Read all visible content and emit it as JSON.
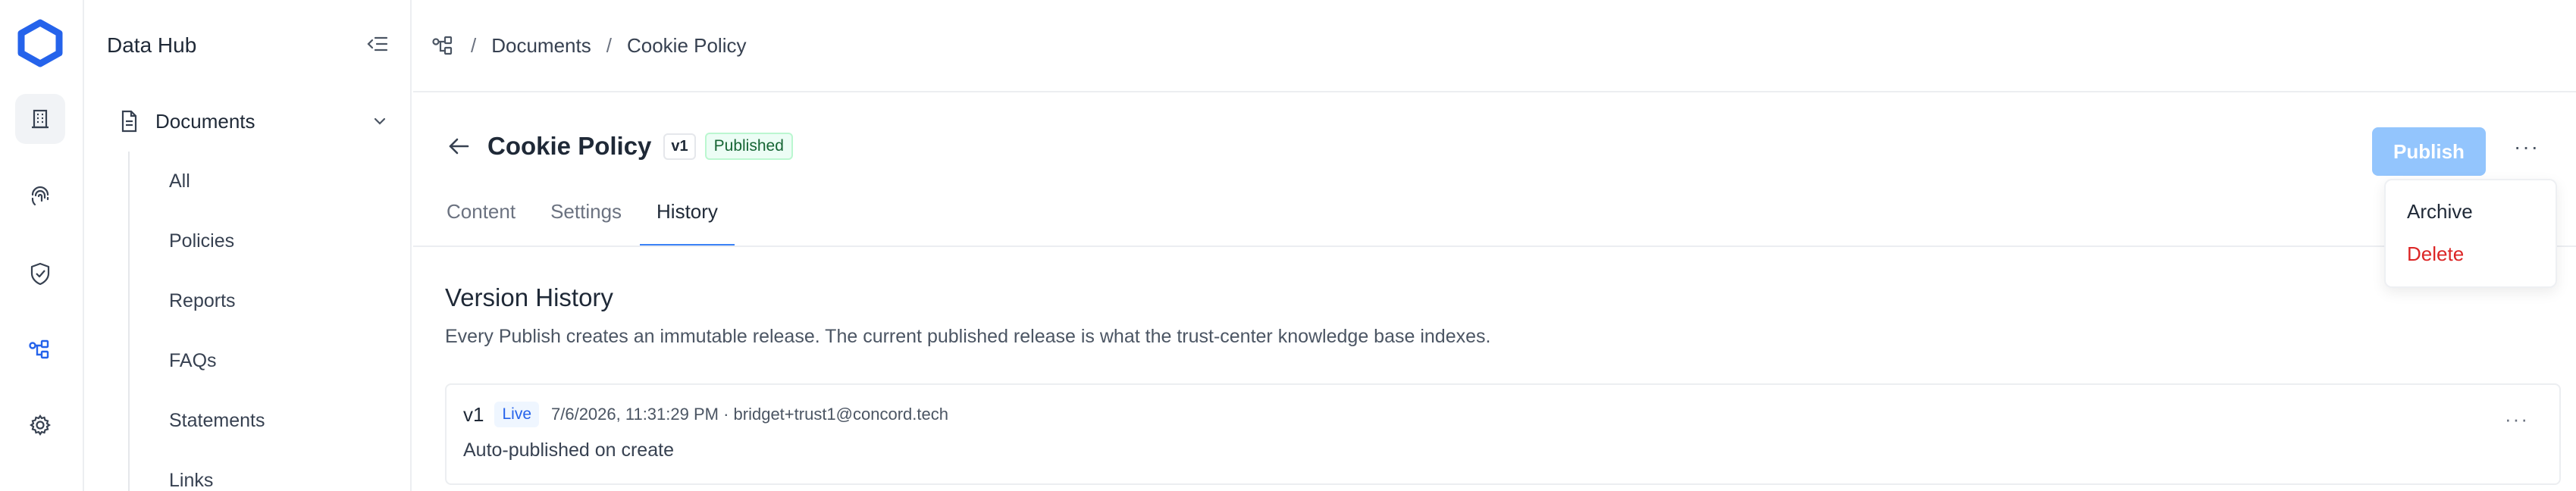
{
  "app": {
    "name": "Data Hub"
  },
  "breadcrumb": [
    "Documents",
    "Cookie Policy"
  ],
  "sidebar": {
    "section_label": "Documents",
    "items": [
      {
        "label": "All"
      },
      {
        "label": "Policies"
      },
      {
        "label": "Reports"
      },
      {
        "label": "FAQs"
      },
      {
        "label": "Statements"
      },
      {
        "label": "Links"
      }
    ]
  },
  "rail": {
    "icons": [
      "building-icon",
      "fingerprint-icon",
      "shield-check-icon",
      "workflow-icon",
      "gear-icon"
    ]
  },
  "document": {
    "title": "Cookie Policy",
    "version_badge": "v1",
    "status_badge": "Published"
  },
  "tabs": [
    {
      "label": "Content",
      "active": false
    },
    {
      "label": "Settings",
      "active": false
    },
    {
      "label": "History",
      "active": true
    }
  ],
  "actions": {
    "publish_label": "Publish",
    "more_label": "···",
    "menu": {
      "archive": "Archive",
      "delete": "Delete"
    }
  },
  "history": {
    "title": "Version History",
    "description": "Every Publish creates an immutable release. The current published release is what the trust-center knowledge base indexes.",
    "releases": [
      {
        "version": "v1",
        "status": "Live",
        "meta": "7/6/2026, 11:31:29 PM · bridget+trust1@concord.tech",
        "note": "Auto-published on create"
      }
    ]
  },
  "colors": {
    "accent": "#3b82f6",
    "publish_disabled": "#93c5fd",
    "danger": "#dc2626",
    "success_text": "#166534"
  }
}
